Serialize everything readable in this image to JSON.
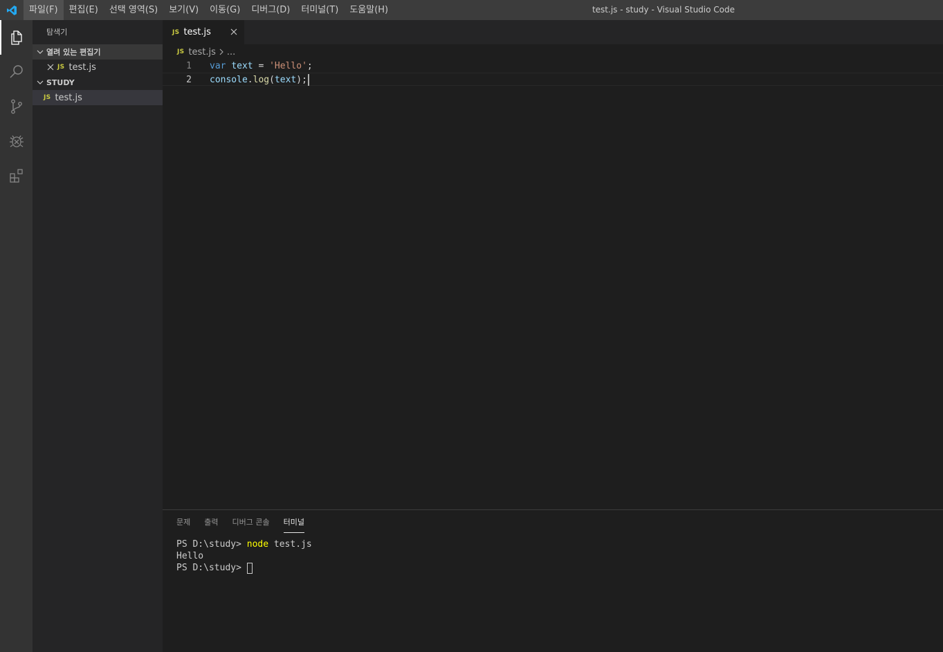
{
  "titlebar": {
    "menu": [
      "파일(F)",
      "편집(E)",
      "선택 영역(S)",
      "보기(V)",
      "이동(G)",
      "디버그(D)",
      "터미널(T)",
      "도움말(H)"
    ],
    "title": "test.js - study - Visual Studio Code"
  },
  "activitybar": {
    "icons": [
      "explorer-icon",
      "search-icon",
      "source-control-icon",
      "debug-icon",
      "extensions-icon"
    ]
  },
  "sidebar": {
    "title": "탐색기",
    "open_editors": {
      "label": "열려 있는 편집기",
      "files": [
        {
          "badge": "JS",
          "name": "test.js"
        }
      ]
    },
    "folder": {
      "label": "STUDY",
      "files": [
        {
          "badge": "JS",
          "name": "test.js"
        }
      ]
    }
  },
  "editor": {
    "tab": {
      "badge": "JS",
      "label": "test.js"
    },
    "breadcrumb": {
      "badge": "JS",
      "file": "test.js",
      "more": "..."
    },
    "lines": [
      {
        "num": "1",
        "tokens": [
          [
            "kw",
            "var"
          ],
          [
            "plain",
            " "
          ],
          [
            "var",
            "text"
          ],
          [
            "plain",
            " = "
          ],
          [
            "str",
            "'Hello'"
          ],
          [
            "plain",
            ";"
          ]
        ]
      },
      {
        "num": "2",
        "tokens": [
          [
            "var",
            "console"
          ],
          [
            "plain",
            "."
          ],
          [
            "fn",
            "log"
          ],
          [
            "plain",
            "("
          ],
          [
            "var",
            "text"
          ],
          [
            "plain",
            ");"
          ]
        ]
      }
    ]
  },
  "panel": {
    "tabs": [
      "문제",
      "출력",
      "디버그 콘솔",
      "터미널"
    ],
    "active_tab": "터미널",
    "terminal": {
      "line1_prompt": "PS D:\\study> ",
      "line1_cmd": "node",
      "line1_args": " test.js",
      "line2": "Hello",
      "line3_prompt": "PS D:\\study> "
    }
  },
  "colors": {
    "accent_blue": "#23a9f2",
    "js_yellow": "#cbcb41"
  }
}
